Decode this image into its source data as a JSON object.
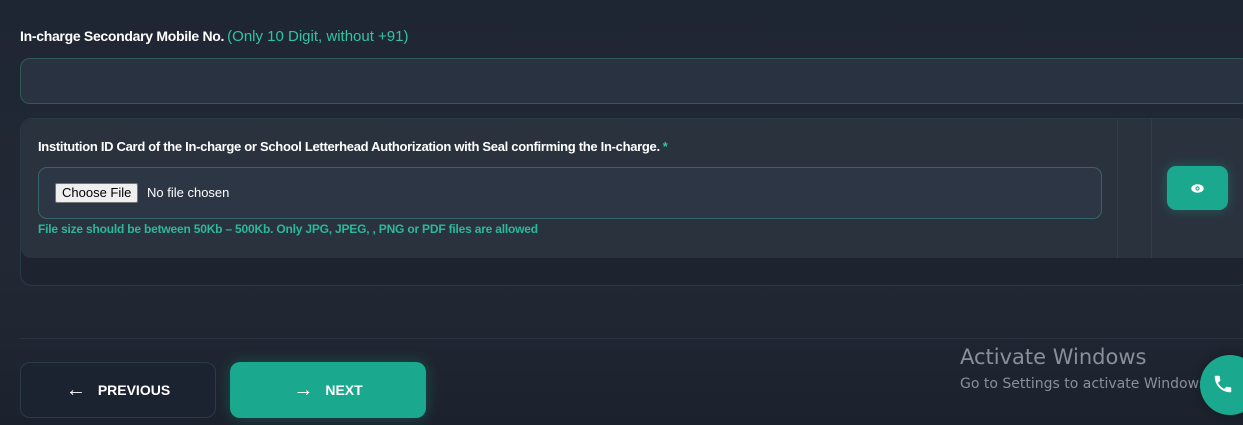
{
  "secondary_mobile": {
    "label": "In-charge Secondary Mobile No.",
    "hint": "(Only 10 Digit, without +91)",
    "value": "",
    "placeholder": ""
  },
  "upload": {
    "title": "Institution ID Card of the In-charge or School Letterhead Authorization with Seal confirming the In-charge.",
    "required_mark": "*",
    "choose_label": "Choose File",
    "file_status": "No file chosen",
    "note": "File size should be between 50Kb – 500Kb. Only JPG, JPEG, , PNG or PDF files are allowed",
    "preview_icon": "eye-icon"
  },
  "nav": {
    "previous_label": "PREVIOUS",
    "next_label": "NEXT",
    "previous_icon": "arrow-left-icon",
    "next_icon": "arrow-right-icon"
  },
  "watermark": {
    "title": "Activate Windows",
    "subtitle": "Go to Settings to activate Windows."
  },
  "fab": {
    "icon": "phone-icon"
  },
  "colors": {
    "accent": "#1aa88f",
    "hint_text": "#2fc4a4",
    "background": "#202734"
  }
}
